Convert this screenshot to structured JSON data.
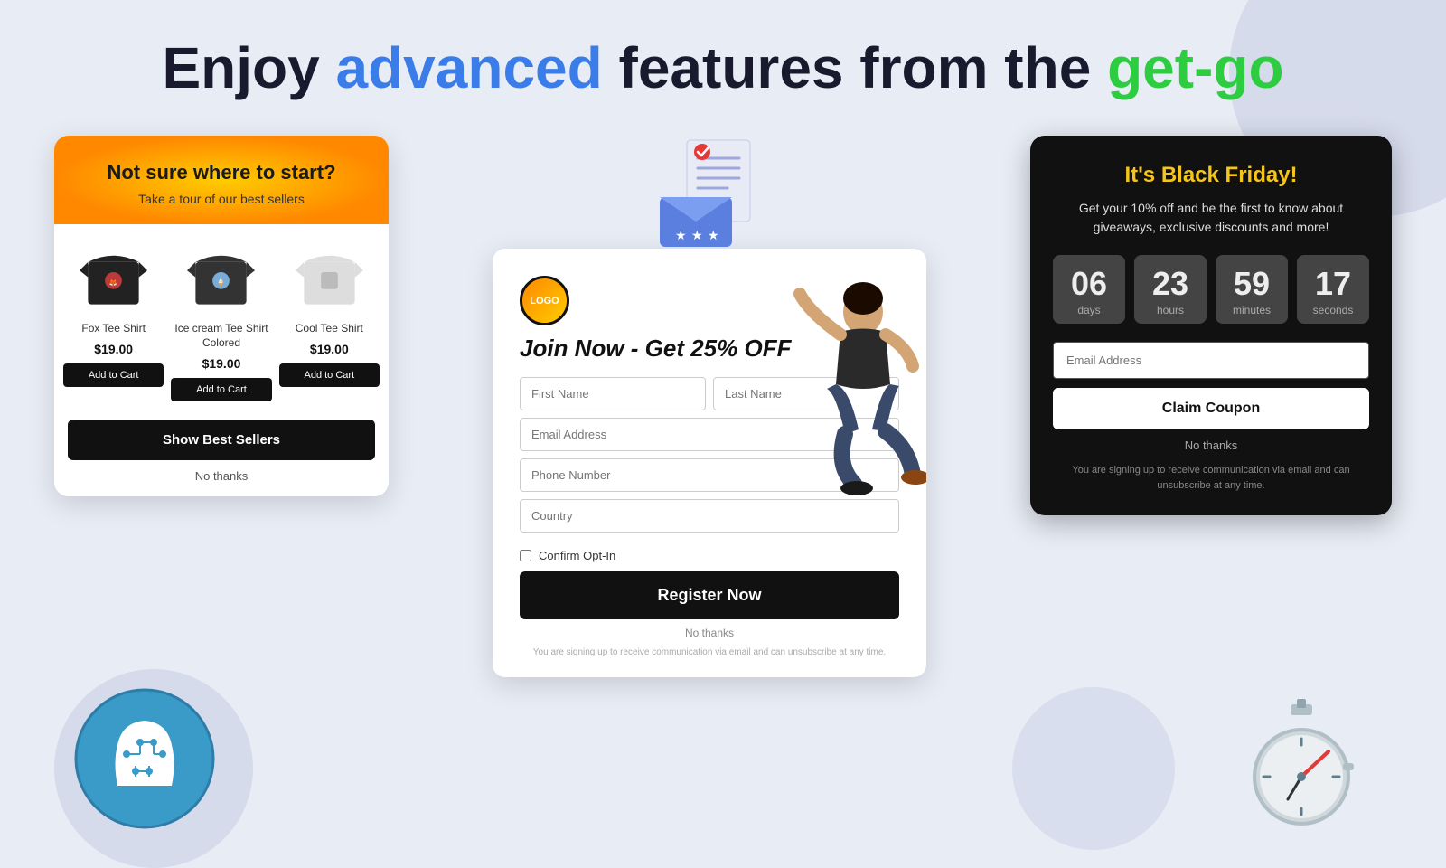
{
  "headline": {
    "part1": "Enjoy ",
    "part2": "advanced",
    "part3": " features from the ",
    "part4": "get-go"
  },
  "bestsellers_card": {
    "title": "Not sure where to start?",
    "subtitle": "Take a tour of our best sellers",
    "products": [
      {
        "name": "Fox Tee Shirt",
        "price": "$19.00",
        "btn": "Add to Cart"
      },
      {
        "name": "Ice cream Tee Shirt Colored",
        "price": "$19.00",
        "btn": "Add to Cart"
      },
      {
        "name": "Cool Tee Shirt",
        "price": "$19.00",
        "btn": "Add to Cart"
      }
    ],
    "show_btn": "Show Best Sellers",
    "no_thanks": "No thanks"
  },
  "register_card": {
    "logo_text": "LOGO",
    "headline": "Join Now - Get 25% OFF",
    "fields": {
      "first_name": "First Name",
      "last_name": "Last Name",
      "email": "Email Address",
      "phone": "Phone Number",
      "country": "Country"
    },
    "checkbox_label": "Confirm Opt-In",
    "register_btn": "Register Now",
    "no_thanks": "No thanks",
    "disclaimer": "You are signing up to receive communication via email and can unsubscribe at any time."
  },
  "blackfriday_card": {
    "title": "It's Black Friday!",
    "subtitle": "Get your 10% off and be the first to know about giveaways, exclusive discounts and more!",
    "countdown": {
      "days_num": "06",
      "days_label": "days",
      "hours_num": "23",
      "hours_label": "hours",
      "minutes_num": "59",
      "minutes_label": "minutes",
      "seconds_num": "17",
      "seconds_label": "seconds"
    },
    "email_placeholder": "Email Address",
    "claim_btn": "Claim Coupon",
    "no_thanks": "No thanks",
    "disclaimer": "You are signing up to receive communication via email and can unsubscribe at any time."
  }
}
